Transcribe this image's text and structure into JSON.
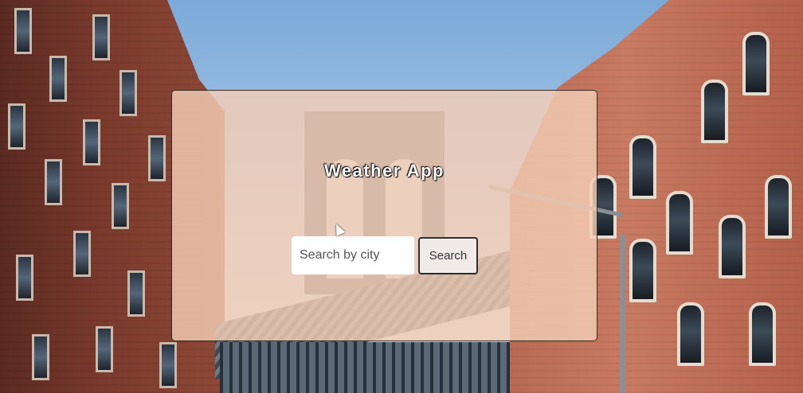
{
  "app": {
    "title": "Weather App"
  },
  "search": {
    "placeholder": "Search by city",
    "value": "",
    "button_label": "Search"
  },
  "colors": {
    "card_overlay": "#f4cdb4",
    "title_text": "#ffffff",
    "button_bg": "#f0ebe8"
  },
  "background": {
    "icon": "city-bridge-photo"
  }
}
